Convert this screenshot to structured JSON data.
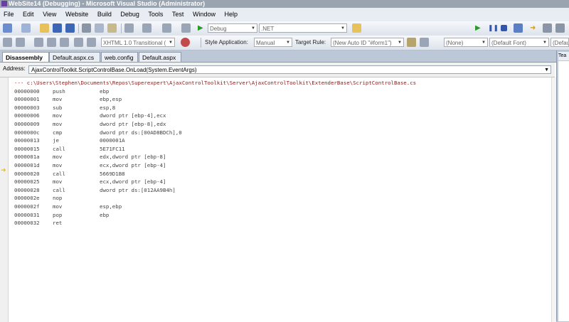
{
  "window": {
    "title": "WebSite14 (Debugging) - Microsoft Visual Studio (Administrator)"
  },
  "menu": [
    "File",
    "Edit",
    "View",
    "Website",
    "Build",
    "Debug",
    "Tools",
    "Test",
    "Window",
    "Help"
  ],
  "toolbar1": {
    "config": "Debug",
    "platform": ".NET"
  },
  "toolbar2": {
    "doctype": "XHTML 1.0 Transitional (",
    "style_app_label": "Style Application:",
    "style_app_value": "Manual",
    "target_rule_label": "Target Rule:",
    "target_rule_value": "(New Auto ID \"#form1\")",
    "style_value": "(None)",
    "font_value": "(Default Font)",
    "size_value": "(Defau"
  },
  "tabs": [
    "Disassembly",
    "Default.aspx.cs",
    "web.config",
    "Default.aspx"
  ],
  "right_panel": {
    "tab": "Tea"
  },
  "address": {
    "label": "Address:",
    "value": "AjaxControlToolkit.ScriptControlBase.OnLoad(System.EventArgs)"
  },
  "code": {
    "header": "--- c:\\Users\\Stephen\\Documents\\Repos\\Superexpert\\AjaxControlToolkit\\Server\\AjaxControlToolkit\\ExtenderBase\\ScriptControlBase.cs",
    "lines": [
      {
        "addr": "00000000",
        "op": "push",
        "args": "ebp"
      },
      {
        "addr": "00000001",
        "op": "mov",
        "args": "ebp,esp"
      },
      {
        "addr": "00000003",
        "op": "sub",
        "args": "esp,8"
      },
      {
        "addr": "00000006",
        "op": "mov",
        "args": "dword ptr [ebp-4],ecx"
      },
      {
        "addr": "00000009",
        "op": "mov",
        "args": "dword ptr [ebp-8],edx"
      },
      {
        "addr": "0000000c",
        "op": "cmp",
        "args": "dword ptr ds:[00AD8BDCh],0"
      },
      {
        "addr": "00000013",
        "op": "je",
        "args": "0000001A"
      },
      {
        "addr": "00000015",
        "op": "call",
        "args": "5E71FC11"
      },
      {
        "addr": "0000001a",
        "op": "mov",
        "args": "edx,dword ptr [ebp-8]"
      },
      {
        "addr": "0000001d",
        "op": "mov",
        "args": "ecx,dword ptr [ebp-4]"
      },
      {
        "addr": "00000020",
        "op": "call",
        "args": "5669D1B8"
      },
      {
        "addr": "00000025",
        "op": "mov",
        "args": "ecx,dword ptr [ebp-4]"
      },
      {
        "addr": "00000028",
        "op": "call",
        "args": "dword ptr ds:[012AA9B4h]"
      },
      {
        "addr": "0000002e",
        "op": "nop",
        "args": ""
      },
      {
        "addr": "0000002f",
        "op": "mov",
        "args": "esp,ebp"
      },
      {
        "addr": "00000031",
        "op": "pop",
        "args": "ebp"
      },
      {
        "addr": "00000032",
        "op": "ret",
        "args": ""
      }
    ]
  },
  "colors": {
    "current_line_marker": "#e8c20a",
    "header_text": "#8b1a1a"
  }
}
